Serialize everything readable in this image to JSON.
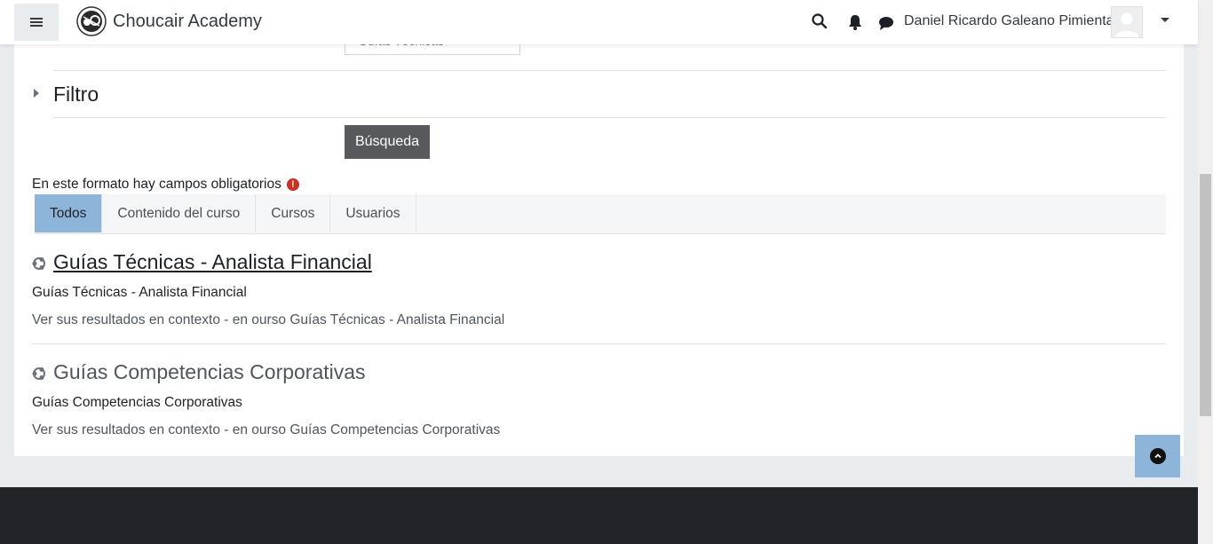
{
  "navbar": {
    "brand_name": "Choucair Academy",
    "user_name": "Daniel Ricardo Galeano Pimienta",
    "icons": [
      "menu-icon",
      "search-icon",
      "bell-icon",
      "chat-icon",
      "chevron-down-icon"
    ]
  },
  "form": {
    "partial_select_value": "Guías Técnicas",
    "filter_title": "Filtro",
    "search_button": "Búsqueda",
    "required_note": "En este formato hay campos obligatorios",
    "required_icon": "!"
  },
  "tabs": [
    {
      "label": "Todos",
      "active": true
    },
    {
      "label": "Contenido del curso",
      "active": false
    },
    {
      "label": "Cursos",
      "active": false
    },
    {
      "label": "Usuarios",
      "active": false
    }
  ],
  "results": [
    {
      "title": "Guías Técnicas - Analista Financial",
      "subtitle": "Guías Técnicas - Analista Financial",
      "context": "Ver sus resultados en contexto - en ourso Guías Técnicas - Analista Financial"
    },
    {
      "title": "Guías Competencias Corporativas",
      "subtitle": "Guías Competencias Corporativas",
      "context": "Ver sus resultados en contexto - en ourso Guías Competencias Corporativas"
    }
  ],
  "colors": {
    "active_tab": "#8db5d9",
    "button": "#58595c",
    "footer": "#212529",
    "required": "#ca3120"
  }
}
